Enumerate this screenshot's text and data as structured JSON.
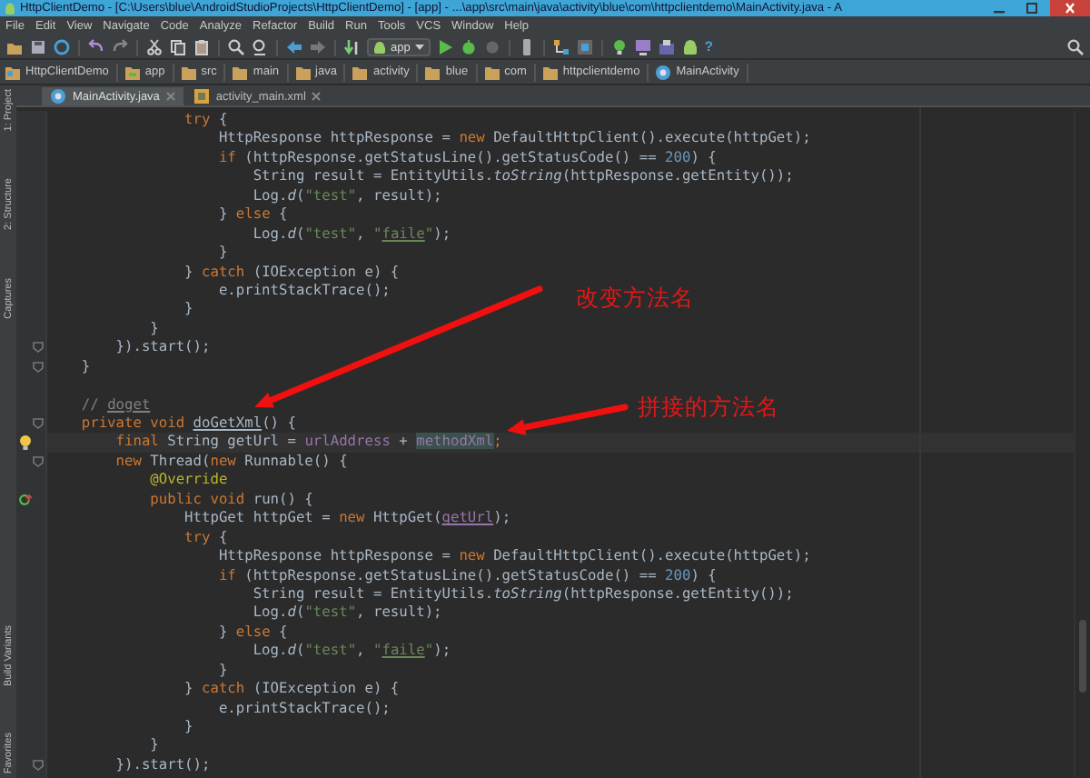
{
  "window": {
    "title": "HttpClientDemo - [C:\\Users\\blue\\AndroidStudioProjects\\HttpClientDemo] - [app] - ...\\app\\src\\main\\java\\activity\\blue\\com\\httpclientdemo\\MainActivity.java - A"
  },
  "menu": [
    "File",
    "Edit",
    "View",
    "Navigate",
    "Code",
    "Analyze",
    "Refactor",
    "Build",
    "Run",
    "Tools",
    "VCS",
    "Window",
    "Help"
  ],
  "toolbar": {
    "run_config": "app",
    "help": "?"
  },
  "breadcrumbs": [
    {
      "label": "HttpClientDemo",
      "kind": "project"
    },
    {
      "label": "app",
      "kind": "module"
    },
    {
      "label": "src",
      "kind": "folder"
    },
    {
      "label": "main",
      "kind": "folder"
    },
    {
      "label": "java",
      "kind": "folder"
    },
    {
      "label": "activity",
      "kind": "folder"
    },
    {
      "label": "blue",
      "kind": "folder"
    },
    {
      "label": "com",
      "kind": "folder"
    },
    {
      "label": "httpclientdemo",
      "kind": "folder"
    },
    {
      "label": "MainActivity",
      "kind": "class"
    }
  ],
  "tabs": [
    {
      "label": "MainActivity.java",
      "kind": "class",
      "selected": true
    },
    {
      "label": "activity_main.xml",
      "kind": "xml",
      "selected": false
    }
  ],
  "tool_strip_top": [
    "1: Project",
    "2: Structure",
    "Captures"
  ],
  "tool_strip_bottom": [
    "Build Variants",
    "Favorites"
  ],
  "code_lines": [
    {
      "tokens": [
        {
          "kind": "keyword",
          "text": "                try"
        },
        {
          "kind": "plain",
          "text": " {"
        }
      ]
    },
    {
      "tokens": [
        {
          "kind": "plain",
          "text": "                    HttpResponse httpResponse = "
        },
        {
          "kind": "keyword",
          "text": "new"
        },
        {
          "kind": "plain",
          "text": " DefaultHttpClient().execute(httpGet);"
        }
      ]
    },
    {
      "tokens": [
        {
          "kind": "keyword",
          "text": "                    if"
        },
        {
          "kind": "plain",
          "text": " (httpResponse.getStatusLine().getStatusCode() == "
        },
        {
          "kind": "number",
          "text": "200"
        },
        {
          "kind": "plain",
          "text": ") {"
        }
      ]
    },
    {
      "tokens": [
        {
          "kind": "plain",
          "text": "                        String result = EntityUtils."
        },
        {
          "kind": "static",
          "text": "toString"
        },
        {
          "kind": "plain",
          "text": "(httpResponse.getEntity());"
        }
      ]
    },
    {
      "tokens": [
        {
          "kind": "plain",
          "text": "                        Log."
        },
        {
          "kind": "static",
          "text": "d"
        },
        {
          "kind": "plain",
          "text": "("
        },
        {
          "kind": "string",
          "text": "\"test\""
        },
        {
          "kind": "plain",
          "text": ", result);"
        }
      ]
    },
    {
      "tokens": [
        {
          "kind": "plain",
          "text": "                    } "
        },
        {
          "kind": "keyword",
          "text": "else"
        },
        {
          "kind": "plain",
          "text": " {"
        }
      ]
    },
    {
      "tokens": [
        {
          "kind": "plain",
          "text": "                        Log."
        },
        {
          "kind": "static",
          "text": "d"
        },
        {
          "kind": "plain",
          "text": "("
        },
        {
          "kind": "string",
          "text": "\"test\""
        },
        {
          "kind": "plain",
          "text": ", "
        },
        {
          "kind": "string",
          "text": "\""
        },
        {
          "kind": "string",
          "text": "faile",
          "underlined": true
        },
        {
          "kind": "string",
          "text": "\""
        },
        {
          "kind": "plain",
          "text": ");"
        }
      ]
    },
    {
      "tokens": [
        {
          "kind": "plain",
          "text": "                    }"
        }
      ]
    },
    {
      "tokens": [
        {
          "kind": "plain",
          "text": "                } "
        },
        {
          "kind": "keyword",
          "text": "catch"
        },
        {
          "kind": "plain",
          "text": " (IOException e) {"
        }
      ]
    },
    {
      "tokens": [
        {
          "kind": "plain",
          "text": "                    e.printStackTrace();"
        }
      ]
    },
    {
      "tokens": [
        {
          "kind": "plain",
          "text": "                }"
        }
      ]
    },
    {
      "tokens": [
        {
          "kind": "plain",
          "text": "            }"
        }
      ]
    },
    {
      "fold": true,
      "tokens": [
        {
          "kind": "plain",
          "text": "        }).start();"
        }
      ]
    },
    {
      "fold": true,
      "space_after": true,
      "tokens": [
        {
          "kind": "plain",
          "text": "    }"
        }
      ]
    },
    {
      "tokens": [
        {
          "kind": "comment",
          "text": "    // "
        },
        {
          "kind": "comment",
          "text": "doget",
          "underlined": true
        }
      ]
    },
    {
      "fold": true,
      "tokens": [
        {
          "kind": "keyword",
          "text": "    private void "
        },
        {
          "kind": "plain",
          "text": "doGetXml",
          "underlined": true
        },
        {
          "kind": "plain",
          "text": "() {"
        }
      ]
    },
    {
      "current": true,
      "bulb": true,
      "tokens": [
        {
          "kind": "keyword",
          "text": "        final "
        },
        {
          "kind": "plain",
          "text": "String getUrl = "
        },
        {
          "kind": "field",
          "text": "urlAddress"
        },
        {
          "kind": "plain",
          "text": " + "
        },
        {
          "kind": "field",
          "text": "methodXml",
          "highlighted": true
        },
        {
          "kind": "keyword",
          "text": ";"
        }
      ]
    },
    {
      "fold": true,
      "tokens": [
        {
          "kind": "keyword",
          "text": "        new "
        },
        {
          "kind": "plain",
          "text": "Thread("
        },
        {
          "kind": "keyword",
          "text": "new "
        },
        {
          "kind": "plain",
          "text": "Runnable() {"
        }
      ]
    },
    {
      "tokens": [
        {
          "kind": "annotation",
          "text": "            @Override"
        }
      ]
    },
    {
      "override_marker": true,
      "tokens": [
        {
          "kind": "keyword",
          "text": "            public void "
        },
        {
          "kind": "plain",
          "text": "run() {"
        }
      ]
    },
    {
      "tokens": [
        {
          "kind": "plain",
          "text": "                HttpGet httpGet = "
        },
        {
          "kind": "keyword",
          "text": "new"
        },
        {
          "kind": "plain",
          "text": " HttpGet("
        },
        {
          "kind": "field",
          "text": "getUrl",
          "underlined": true
        },
        {
          "kind": "plain",
          "text": ");"
        }
      ]
    },
    {
      "tokens": [
        {
          "kind": "keyword",
          "text": "                try"
        },
        {
          "kind": "plain",
          "text": " {"
        }
      ]
    },
    {
      "tokens": [
        {
          "kind": "plain",
          "text": "                    HttpResponse httpResponse = "
        },
        {
          "kind": "keyword",
          "text": "new"
        },
        {
          "kind": "plain",
          "text": " DefaultHttpClient().execute(httpGet);"
        }
      ]
    },
    {
      "tokens": [
        {
          "kind": "keyword",
          "text": "                    if"
        },
        {
          "kind": "plain",
          "text": " (httpResponse.getStatusLine().getStatusCode() == "
        },
        {
          "kind": "number",
          "text": "200"
        },
        {
          "kind": "plain",
          "text": ") {"
        }
      ]
    },
    {
      "tokens": [
        {
          "kind": "plain",
          "text": "                        String result = EntityUtils."
        },
        {
          "kind": "static",
          "text": "toString"
        },
        {
          "kind": "plain",
          "text": "(httpResponse.getEntity());"
        }
      ]
    },
    {
      "tokens": [
        {
          "kind": "plain",
          "text": "                        Log."
        },
        {
          "kind": "static",
          "text": "d"
        },
        {
          "kind": "plain",
          "text": "("
        },
        {
          "kind": "string",
          "text": "\"test\""
        },
        {
          "kind": "plain",
          "text": ", result);"
        }
      ]
    },
    {
      "tokens": [
        {
          "kind": "plain",
          "text": "                    } "
        },
        {
          "kind": "keyword",
          "text": "else"
        },
        {
          "kind": "plain",
          "text": " {"
        }
      ]
    },
    {
      "tokens": [
        {
          "kind": "plain",
          "text": "                        Log."
        },
        {
          "kind": "static",
          "text": "d"
        },
        {
          "kind": "plain",
          "text": "("
        },
        {
          "kind": "string",
          "text": "\"test\""
        },
        {
          "kind": "plain",
          "text": ", "
        },
        {
          "kind": "string",
          "text": "\""
        },
        {
          "kind": "string",
          "text": "faile",
          "underlined": true
        },
        {
          "kind": "string",
          "text": "\""
        },
        {
          "kind": "plain",
          "text": ");"
        }
      ]
    },
    {
      "tokens": [
        {
          "kind": "plain",
          "text": "                    }"
        }
      ]
    },
    {
      "tokens": [
        {
          "kind": "plain",
          "text": "                } "
        },
        {
          "kind": "keyword",
          "text": "catch"
        },
        {
          "kind": "plain",
          "text": " (IOException e) {"
        }
      ]
    },
    {
      "tokens": [
        {
          "kind": "plain",
          "text": "                    e.printStackTrace();"
        }
      ]
    },
    {
      "tokens": [
        {
          "kind": "plain",
          "text": "                }"
        }
      ]
    },
    {
      "tokens": [
        {
          "kind": "plain",
          "text": "            }"
        }
      ]
    },
    {
      "fold": true,
      "tokens": [
        {
          "kind": "plain",
          "text": "        }).start();"
        }
      ]
    }
  ],
  "annotations": [
    {
      "text": "改变方法名",
      "kind": "arrow-note"
    },
    {
      "text": "拼接的方法名",
      "kind": "arrow-note"
    }
  ]
}
